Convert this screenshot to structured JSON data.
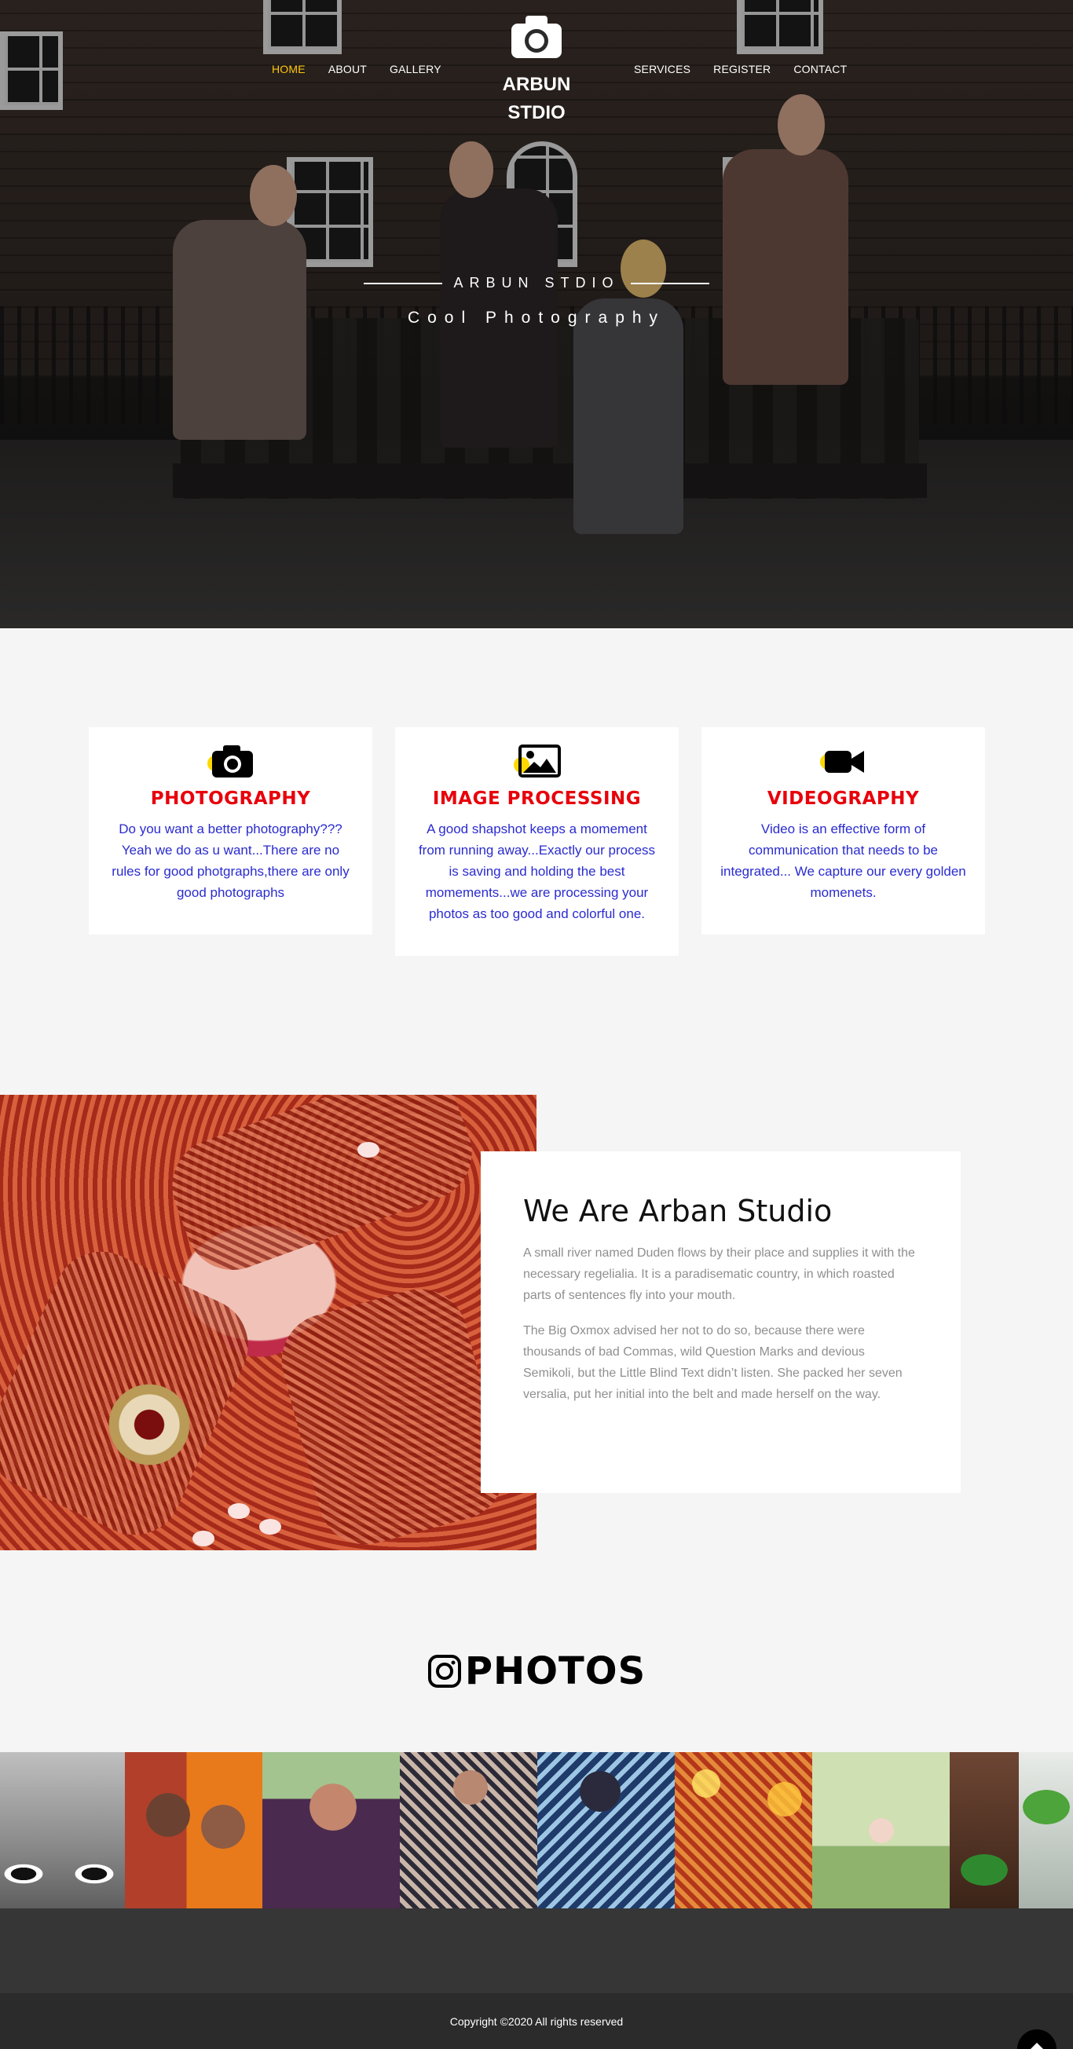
{
  "nav": {
    "left": [
      {
        "label": "HOME",
        "active": true
      },
      {
        "label": "ABOUT",
        "active": false
      },
      {
        "label": "GALLERY",
        "active": false
      }
    ],
    "right": [
      {
        "label": "SERVICES",
        "active": false
      },
      {
        "label": "REGISTER",
        "active": false
      },
      {
        "label": "CONTACT",
        "active": false
      }
    ],
    "active_color": "#ffc60b"
  },
  "logo": {
    "icon": "camera-icon",
    "line1": "ARBUN",
    "line2": "STDIO"
  },
  "hero": {
    "title": "ARBUN STDIO",
    "subtitle": "Cool Photography"
  },
  "services": [
    {
      "icon": "camera-icon",
      "title": "PHOTOGRAPHY",
      "text": "Do you want a better photography??? Yeah we do as u want...There are no rules for good photgraphs,there are only good photographs"
    },
    {
      "icon": "image-icon",
      "title": "IMAGE PROCESSING",
      "text": "A good shapshot keeps a momement from running away...Exactly our process is saving and holding the best momements...we are processing your photos as too good and colorful one."
    },
    {
      "icon": "video-camera-icon",
      "title": "VIDEOGRAPHY",
      "text": "Video is an effective form of communication that needs to be integrated... We capture our every golden momenets."
    }
  ],
  "about": {
    "heading": "We Are Arban Studio",
    "paragraph1": "A small river named Duden flows by their place and supplies it with the necessary regelialia. It is a paradisematic country, in which roasted parts of sentences fly into your mouth.",
    "paragraph2": "The Big Oxmox advised her not to do so, because there were thousands of bad Commas, wild Question Marks and devious Semikoli, but the Little Blind Text didn’t listen. She packed her seven versalia, put her initial into the belt and made herself on the way."
  },
  "photos": {
    "icon": "instagram-icon",
    "heading": "PHOTOS"
  },
  "footer": {
    "copyright": "Copyright ©2020 All rights reserved",
    "to_top_icon": "arrow-up-icon"
  },
  "colors": {
    "service_title": "#e8000b",
    "service_text": "#2a2bcf",
    "icon_accent": "#ffd800"
  }
}
